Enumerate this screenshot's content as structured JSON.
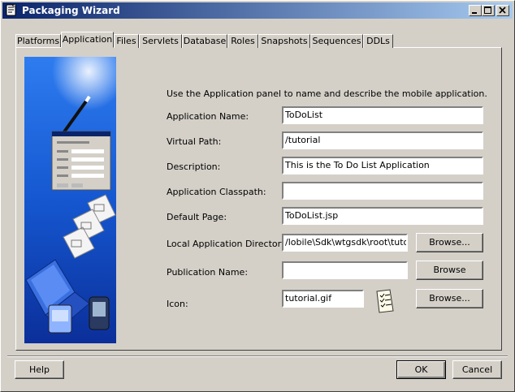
{
  "window": {
    "title": "Packaging Wizard"
  },
  "tabs": [
    {
      "label": "Platforms"
    },
    {
      "label": "Application"
    },
    {
      "label": "Files"
    },
    {
      "label": "Servlets"
    },
    {
      "label": "Database"
    },
    {
      "label": "Roles"
    },
    {
      "label": "Snapshots"
    },
    {
      "label": "Sequences"
    },
    {
      "label": "DDLs"
    }
  ],
  "panel": {
    "intro": "Use the Application panel to name and describe the mobile application.",
    "fields": {
      "app_name": {
        "label": "Application Name:",
        "value": "ToDoList"
      },
      "virtual_path": {
        "label": "Virtual Path:",
        "value": "/tutorial"
      },
      "description": {
        "label": "Description:",
        "value": "This is the To Do List Application"
      },
      "classpath": {
        "label": "Application Classpath:",
        "value": ""
      },
      "default_page": {
        "label": "Default Page:",
        "value": "ToDoList.jsp"
      },
      "local_dir": {
        "label": "Local Application Directory:",
        "value": "/lobile\\Sdk\\wtgsdk\\root\\tutorial\\"
      },
      "publication": {
        "label": "Publication Name:",
        "value": ""
      },
      "icon": {
        "label": "Icon:",
        "value": "tutorial.gif"
      }
    },
    "browse_local": "Browse...",
    "browse_publication": "Browse",
    "browse_icon": "Browse..."
  },
  "footer": {
    "help": "Help",
    "ok": "OK",
    "cancel": "Cancel"
  },
  "colors": {
    "titlebar_start": "#0a246a",
    "titlebar_end": "#a6caf0",
    "banner": "#1a5fd6",
    "face": "#d4d0c8"
  },
  "icons": [
    "window-icon",
    "minimize-icon",
    "maximize-icon",
    "close-icon",
    "checklist-icon",
    "wizard-banner-illustration"
  ]
}
